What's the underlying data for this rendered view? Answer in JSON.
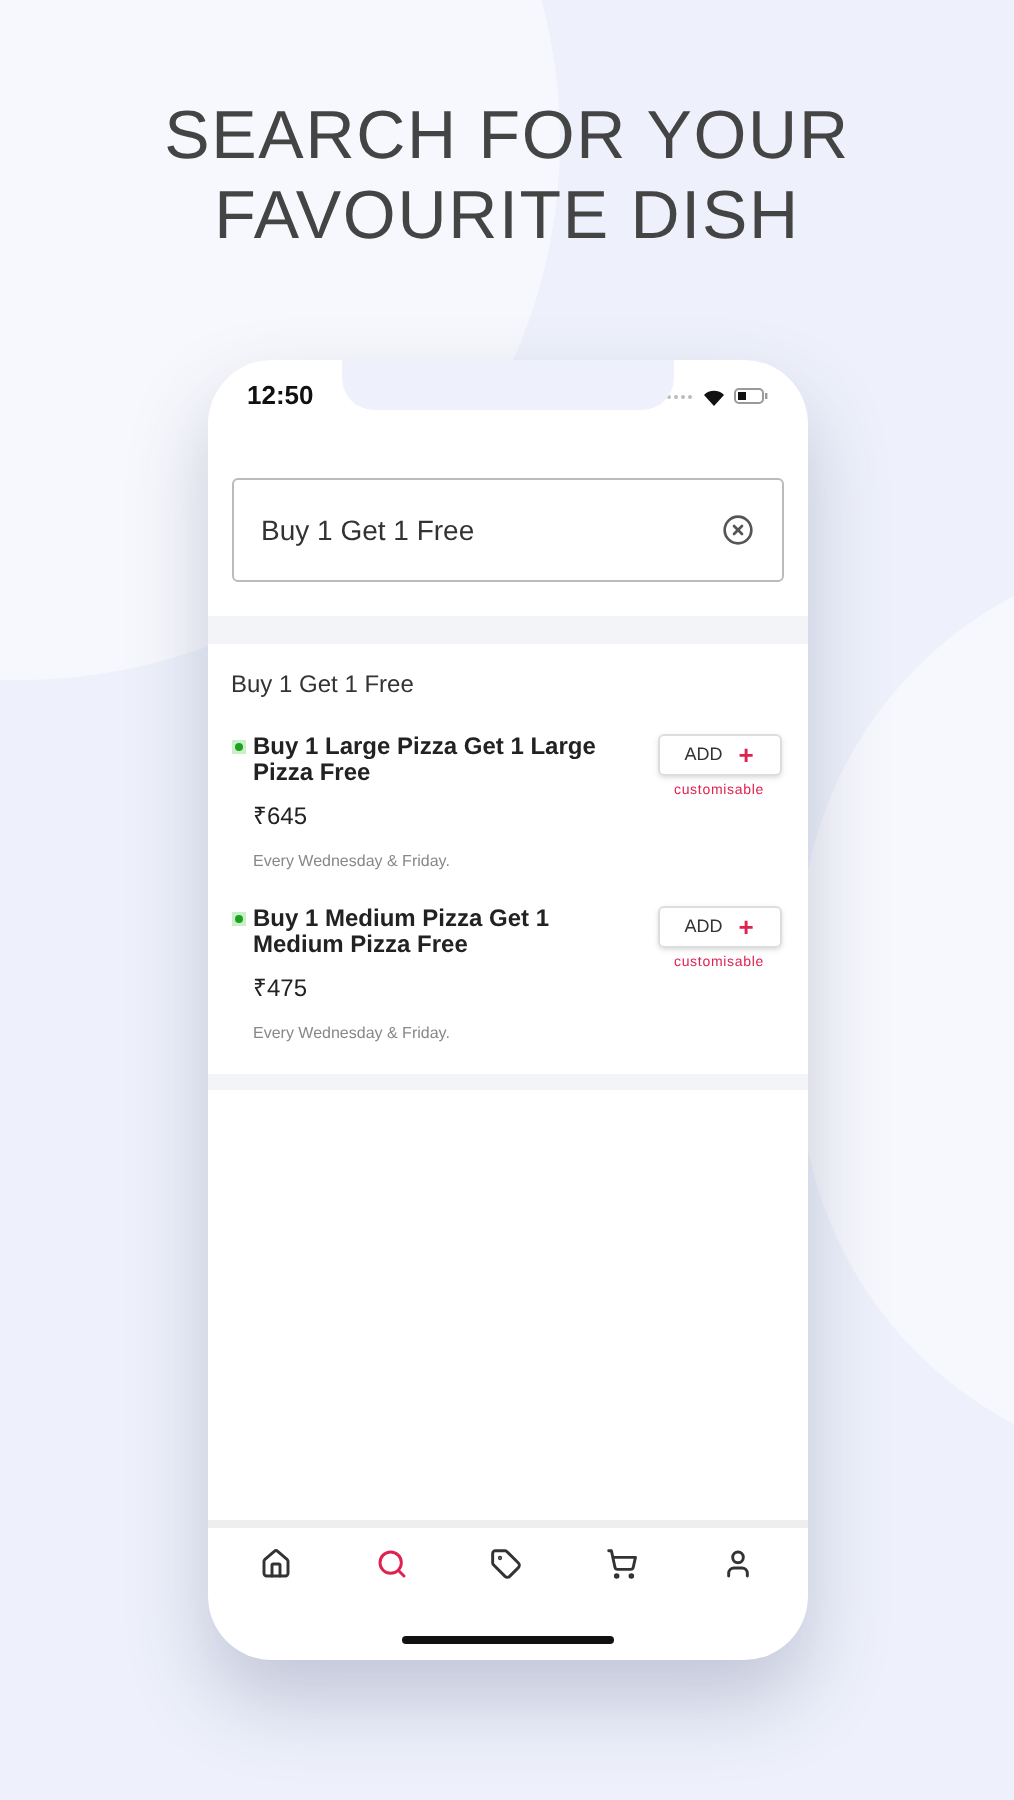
{
  "headline": "SEARCH FOR YOUR FAVOURITE DISH",
  "status_bar": {
    "time": "12:50"
  },
  "search": {
    "value": "Buy 1 Get 1 Free"
  },
  "results": {
    "heading": "Buy 1 Get 1 Free",
    "items": [
      {
        "name": "Buy 1 Large Pizza Get 1 Large Pizza Free",
        "price": "₹645",
        "note": "Every Wednesday & Friday.",
        "button": "ADD",
        "button_icon": "+",
        "tag": "customisable"
      },
      {
        "name": "Buy 1 Medium Pizza Get 1 Medium Pizza Free",
        "price": "₹475",
        "note": "Every Wednesday & Friday.",
        "button": "ADD",
        "button_icon": "+",
        "tag": "customisable"
      }
    ]
  },
  "bottom_nav": [
    {
      "kind": "home",
      "selected": false
    },
    {
      "kind": "search",
      "selected": true
    },
    {
      "kind": "offers",
      "selected": false
    },
    {
      "kind": "cart",
      "selected": false
    },
    {
      "kind": "profile",
      "selected": false
    }
  ]
}
